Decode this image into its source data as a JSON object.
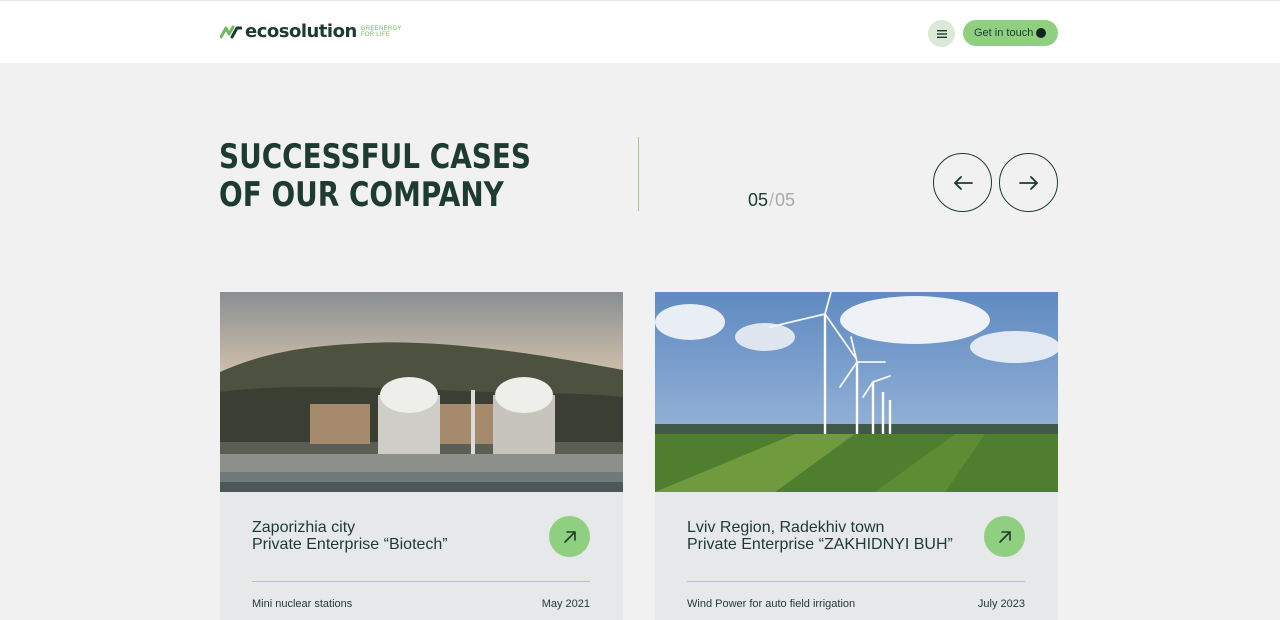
{
  "header": {
    "logo_text": "ecosolution",
    "logo_tagline_1": "GREENERGY",
    "logo_tagline_2": "FOR LIFE",
    "menu_icon": "hamburger-icon",
    "cta_label": "Get in touch"
  },
  "section": {
    "title_line1": "SUCCESSFUL CASES",
    "title_line2": "OF OUR COMPANY",
    "counter_current": "05",
    "counter_separator": "/",
    "counter_total": "05",
    "prev_icon": "arrow-left-icon",
    "next_icon": "arrow-right-icon"
  },
  "cases": [
    {
      "title_line1": "Zaporizhia city",
      "title_line2": "Private Enterprise “Biotech”",
      "category": "Mini nuclear stations",
      "date": "May 2021",
      "image": "nuclear-power-plant-photo"
    },
    {
      "title_line1": "Lviv Region, Radekhiv town",
      "title_line2": "Private Enterprise “ZAKHIDNYI BUH”",
      "category": "Wind Power for auto field irrigation",
      "date": "July 2023",
      "image": "wind-turbines-field-photo"
    }
  ],
  "colors": {
    "accent_green": "#8fcf80",
    "dark_green": "#1d3b30",
    "background": "#f1f1f1",
    "card_bg": "#e6e8e9"
  }
}
